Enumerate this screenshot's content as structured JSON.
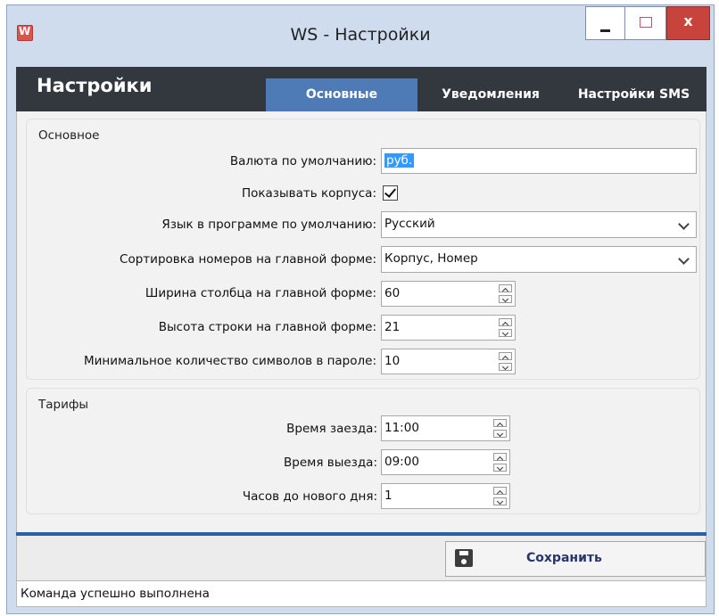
{
  "window": {
    "title": "WS - Настройки",
    "close_glyph": "x"
  },
  "header": {
    "title": "Настройки",
    "tabs": [
      {
        "label": "Основные",
        "active": true
      },
      {
        "label": "Уведомления",
        "active": false
      },
      {
        "label": "Настройки SMS",
        "active": false
      }
    ]
  },
  "general": {
    "group_title": "Основное",
    "currency_label": "Валюта по умолчанию:",
    "currency_value": "руб.",
    "show_buildings_label": "Показывать корпуса:",
    "show_buildings_checked": true,
    "language_label": "Язык в программе по умолчанию:",
    "language_value": "Русский",
    "sort_label": "Сортировка номеров на главной форме:",
    "sort_value": "Корпус, Номер",
    "column_width_label": "Ширина столбца на главной форме:",
    "column_width_value": "60",
    "row_height_label": "Высота строки на главной форме:",
    "row_height_value": "21",
    "min_password_label": "Минимальное количество символов в пароле:",
    "min_password_value": "10"
  },
  "tariffs": {
    "group_title": "Тарифы",
    "checkin_label": "Время заезда:",
    "checkin_value": "11:00",
    "checkout_label": "Время выезда:",
    "checkout_value": "09:00",
    "hours_label": "Часов до нового дня:",
    "hours_value": "1"
  },
  "footer": {
    "save_label": "Сохранить"
  },
  "status": {
    "text": "Команда успешно выполнена"
  },
  "colors": {
    "header_bg": "#33373e",
    "active_tab": "#4e7bb5",
    "accent_line": "#2e5fa3",
    "close_button": "#c7433b"
  }
}
